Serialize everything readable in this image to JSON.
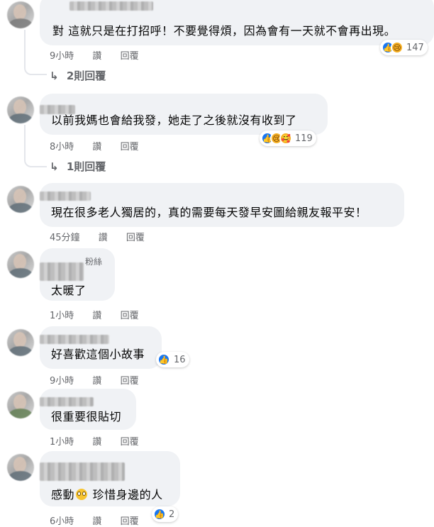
{
  "comments": [
    {
      "text": "對 這就只是在打招呼！不要覺得煩，因為會有一天就不會再出現。",
      "time": "9小時",
      "like_label": "讚",
      "reply_label": "回覆",
      "reaction_count": "147",
      "replies_label": "2則回覆"
    },
    {
      "text": "以前我媽也會給我發，她走了之後就沒有收到了",
      "time": "8小時",
      "like_label": "讚",
      "reply_label": "回覆",
      "reaction_count": "119",
      "replies_label": "1則回覆"
    },
    {
      "text": "現在很多老人獨居的，真的需要每天發早安圖給親友報平安！",
      "time": "45分鐘",
      "like_label": "讚",
      "reply_label": "回覆"
    },
    {
      "badge": "粉絲",
      "text": "太暖了",
      "time": "1小時",
      "like_label": "讚",
      "reply_label": "回覆"
    },
    {
      "text": "好喜歡這個小故事",
      "time": "9小時",
      "like_label": "讚",
      "reply_label": "回覆",
      "reaction_count": "16"
    },
    {
      "text": "很重要很貼切",
      "time": "1小時",
      "like_label": "讚",
      "reply_label": "回覆"
    },
    {
      "text_before": "感動",
      "text_after": " 珍惜身邊的人",
      "time": "6小時",
      "like_label": "讚",
      "reply_label": "回覆",
      "reaction_count": "2"
    }
  ],
  "icons": {
    "like": "thumbs-up-icon",
    "sad": "sad-face-icon",
    "care": "care-face-icon",
    "reply_arrow": "reply-arrow-icon"
  },
  "colors": {
    "accent": "#1877f2",
    "bubble": "#f0f2f5",
    "meta": "#65676b"
  }
}
